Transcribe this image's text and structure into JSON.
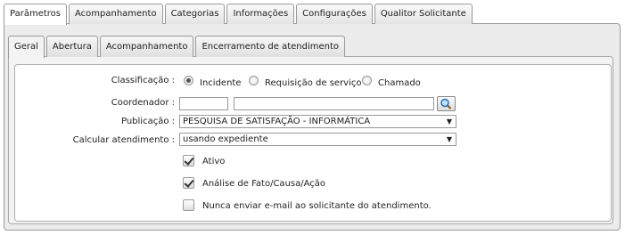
{
  "top_tabs": [
    "Parâmetros",
    "Acompanhamento",
    "Categorias",
    "Informações",
    "Configurações",
    "Qualitor Solicitante"
  ],
  "inner_tabs": [
    "Geral",
    "Abertura",
    "Acompanhamento",
    "Encerramento de atendimento"
  ],
  "form": {
    "classificacao": {
      "label": "Classificação :",
      "options": [
        "Incidente",
        "Requisição de serviço",
        "Chamado"
      ],
      "selected": "Incidente"
    },
    "coordenador": {
      "label": "Coordenador :",
      "code_value": "",
      "name_value": ""
    },
    "publicacao": {
      "label": "Publicação :",
      "value": "PESQUISA DE SATISFAÇÃO - INFORMÁTICA"
    },
    "calcular": {
      "label": "Calcular atendimento :",
      "value": "usando expediente"
    },
    "checkboxes": [
      {
        "label": "Ativo",
        "checked": true
      },
      {
        "label": "Análise de Fato/Causa/Ação",
        "checked": true
      },
      {
        "label": "Nunca enviar e-mail ao solicitante do atendimento.",
        "checked": false
      }
    ]
  },
  "icons": {
    "search": "search-icon",
    "dropdown": "chevron-down-icon"
  }
}
